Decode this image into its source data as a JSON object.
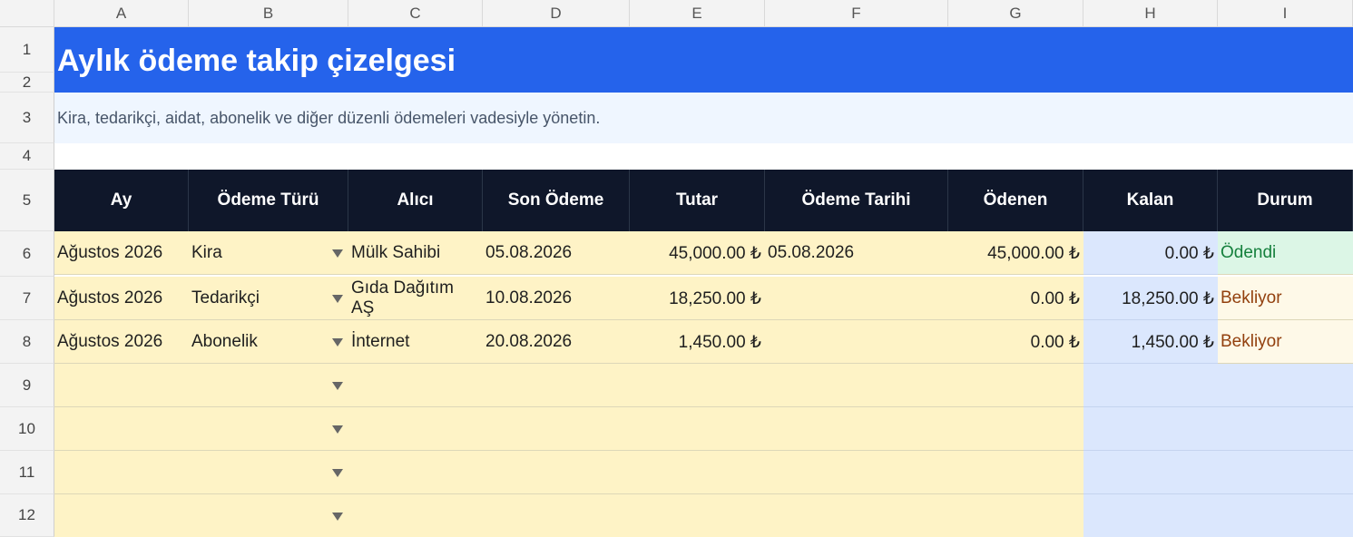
{
  "columns": [
    "A",
    "B",
    "C",
    "D",
    "E",
    "F",
    "G",
    "H",
    "I"
  ],
  "rows": [
    "1",
    "2",
    "3",
    "4",
    "5",
    "6",
    "7",
    "8",
    "9",
    "10",
    "11",
    "12"
  ],
  "sheet": {
    "title": "Aylık ödeme takip çizelgesi",
    "subtitle": "Kira, tedarikçi, aidat, abonelik ve diğer düzenli ödemeleri vadesiyle yönetin."
  },
  "table": {
    "headers": [
      "Ay",
      "Ödeme Türü",
      "Alıcı",
      "Son Ödeme",
      "Tutar",
      "Ödeme Tarihi",
      "Ödenen",
      "Kalan",
      "Durum"
    ],
    "rows": [
      {
        "ay": "Ağustos 2026",
        "tur": "Kira",
        "alici": "Mülk Sahibi",
        "son": "05.08.2026",
        "tutar": "45,000.00 ₺",
        "tarih": "05.08.2026",
        "odenen": "45,000.00 ₺",
        "kalan": "0.00 ₺",
        "durum": "Ödendi"
      },
      {
        "ay": "Ağustos 2026",
        "tur": "Tedarikçi",
        "alici": "Gıda Dağıtım AŞ",
        "son": "10.08.2026",
        "tutar": "18,250.00 ₺",
        "tarih": "",
        "odenen": "0.00 ₺",
        "kalan": "18,250.00 ₺",
        "durum": "Bekliyor"
      },
      {
        "ay": "Ağustos 2026",
        "tur": "Abonelik",
        "alici": "İnternet",
        "son": "20.08.2026",
        "tutar": "1,450.00 ₺",
        "tarih": "",
        "odenen": "0.00 ₺",
        "kalan": "1,450.00 ₺",
        "durum": "Bekliyor"
      }
    ]
  },
  "colors": {
    "title_band": "#2563eb",
    "header_band": "#0f172a",
    "input_fill": "#fef3c6",
    "calc_fill": "#dbe7fd",
    "paid": "#15803d",
    "waiting": "#92400e"
  }
}
